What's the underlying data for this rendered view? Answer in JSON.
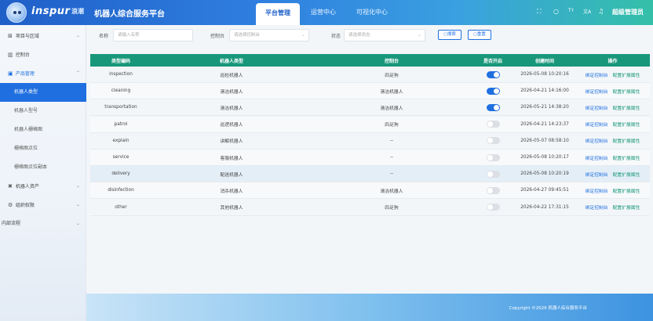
{
  "header": {
    "brand": "inspur",
    "brand_sub": "浪潮",
    "title": "机器人综合服务平台",
    "tabs": [
      {
        "label": "平台管理",
        "active": true
      },
      {
        "label": "运营中心",
        "active": false
      },
      {
        "label": "可视化中心",
        "active": false
      }
    ],
    "icons": [
      "fullscreen-icon",
      "search-icon",
      "font-size-icon",
      "translate-icon",
      "bell-icon"
    ],
    "icon_glyphs": [
      "⛶",
      "○",
      "Tт",
      "文A",
      "♫"
    ],
    "user": "超级管理员"
  },
  "sidebar": {
    "items": [
      {
        "label": "项目与区域",
        "icon": "⊠",
        "chevron": "⌄",
        "type": "parent"
      },
      {
        "label": "控制台",
        "icon": "▥",
        "chevron": "",
        "type": "parent"
      },
      {
        "label": "产品管理",
        "icon": "▣",
        "chevron": "⌃",
        "type": "open"
      },
      {
        "label": "机器人类型",
        "icon": "",
        "chevron": "",
        "type": "active"
      },
      {
        "label": "机器人型号",
        "icon": "",
        "chevron": "",
        "type": "sub"
      },
      {
        "label": "机器人栅格图",
        "icon": "",
        "chevron": "",
        "type": "sub"
      },
      {
        "label": "栅格图点位",
        "icon": "",
        "chevron": "",
        "type": "sub"
      },
      {
        "label": "栅格图点位副本",
        "icon": "",
        "chevron": "",
        "type": "sub"
      },
      {
        "label": "机器人资产",
        "icon": "✖",
        "chevron": "⌄",
        "type": "parent"
      },
      {
        "label": "组织权限",
        "icon": "⚙",
        "chevron": "⌄",
        "type": "parent"
      },
      {
        "label": "内部流程",
        "icon": "",
        "chevron": "⌄",
        "type": "parent"
      }
    ]
  },
  "filter": {
    "name_label": "名称",
    "name_placeholder": "请输入名称",
    "console_label": "控制台",
    "console_placeholder": "请选择控制台",
    "status_label": "状态",
    "status_placeholder": "请选择状态",
    "search_btn": "○搜索",
    "reset_btn": "○重置"
  },
  "table": {
    "headers": [
      "类型编码",
      "机器人类型",
      "控制台",
      "是否开启",
      "创建时间",
      "操作"
    ],
    "actions": [
      "绑定控制台",
      "配置扩展属性"
    ],
    "rows": [
      {
        "code": "inspection",
        "type": "巡检机器人",
        "console": "四足狗",
        "enabled": true,
        "created": "2026-05-08 10:20:16"
      },
      {
        "code": "cleaning",
        "type": "清洁机器人",
        "console": "清洁机器人",
        "enabled": true,
        "created": "2026-04-21 14:16:00"
      },
      {
        "code": "transportation",
        "type": "清洁机器人",
        "console": "清洁机器人",
        "enabled": true,
        "created": "2026-05-21 14:38:20"
      },
      {
        "code": "patrol",
        "type": "巡逻机器人",
        "console": "四足狗",
        "enabled": false,
        "created": "2026-04-21 14:23:37"
      },
      {
        "code": "explain",
        "type": "讲解机器人",
        "console": "--",
        "enabled": false,
        "created": "2026-05-07 08:58:10"
      },
      {
        "code": "service",
        "type": "客服机器人",
        "console": "--",
        "enabled": false,
        "created": "2026-05-08 10:20:17"
      },
      {
        "code": "delivery",
        "type": "配送机器人",
        "console": "--",
        "enabled": false,
        "created": "2026-05-08 10:20:19"
      },
      {
        "code": "disinfection",
        "type": "消杀机器人",
        "console": "清洁机器人",
        "enabled": false,
        "created": "2026-04-27 09:45:51"
      },
      {
        "code": "other",
        "type": "其他机器人",
        "console": "四足狗",
        "enabled": false,
        "created": "2026-04-22 17:31:15"
      }
    ]
  },
  "footer": {
    "copyright": "Copyright ©2026 机器人综合服务平台"
  },
  "colors": {
    "primary": "#1f6fe0",
    "table_header": "#18977a"
  }
}
